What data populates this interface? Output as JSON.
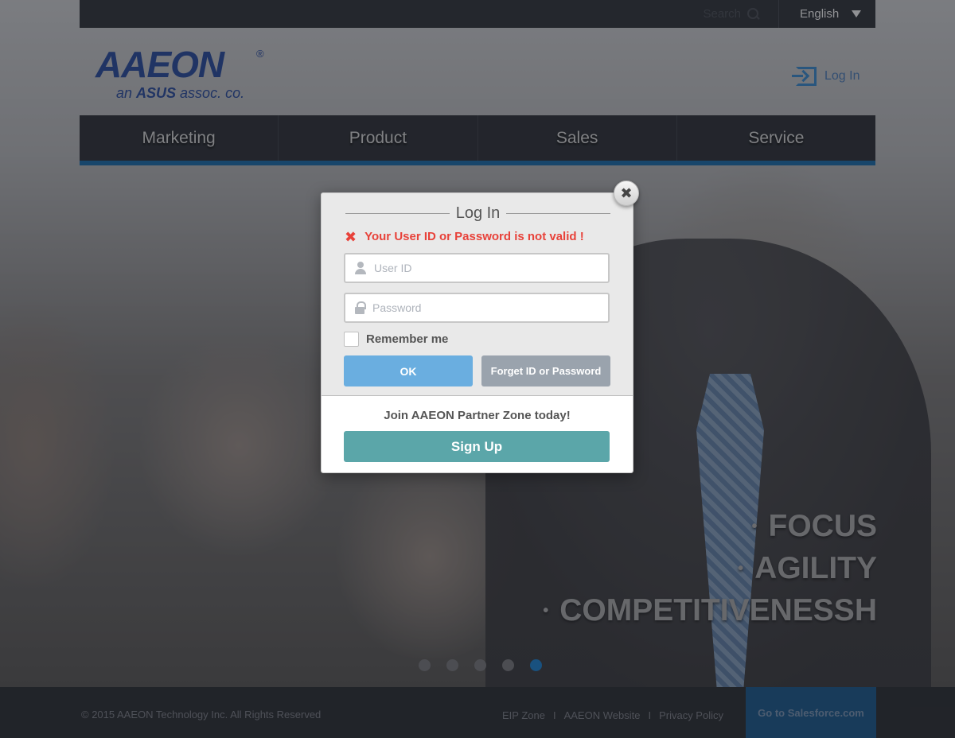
{
  "topbar": {
    "search_placeholder": "Search",
    "language": "English"
  },
  "header": {
    "logo_main": "AAEON",
    "logo_reg": "®",
    "logo_sub_prefix": "an ",
    "logo_sub_brand": "ASUS",
    "logo_sub_suffix": " assoc. co.",
    "login_label": "Log In"
  },
  "nav": {
    "items": [
      "Marketing",
      "Product",
      "Sales",
      "Service"
    ]
  },
  "hero": {
    "slogan": [
      "FOCUS",
      "AGILITY",
      "COMPETITIVENESSH"
    ],
    "bullet": "•",
    "carousel_count": 5,
    "carousel_active": 5
  },
  "modal": {
    "title": "Log In",
    "error": "Your User ID or Password is not valid !",
    "user_placeholder": "User ID",
    "password_placeholder": "Password",
    "remember_label": "Remember me",
    "ok_label": "OK",
    "forget_label": "Forget ID or Password",
    "join_text": "Join AAEON Partner Zone today!",
    "signup_label": "Sign Up",
    "close_glyph": "✖",
    "error_glyph": "✖"
  },
  "footer": {
    "copyright": "© 2015 AAEON Technology Inc. All Rights Reserved",
    "links": [
      "EIP Zone",
      "AAEON Website",
      "Privacy Policy"
    ],
    "separator": "I",
    "salesforce_label": "Go to Salesforce.com"
  },
  "colors": {
    "accent_blue": "#0c5d9c",
    "error_red": "#e8423a",
    "ok_button": "#6aaee0",
    "signup_button": "#5ba6a9"
  }
}
